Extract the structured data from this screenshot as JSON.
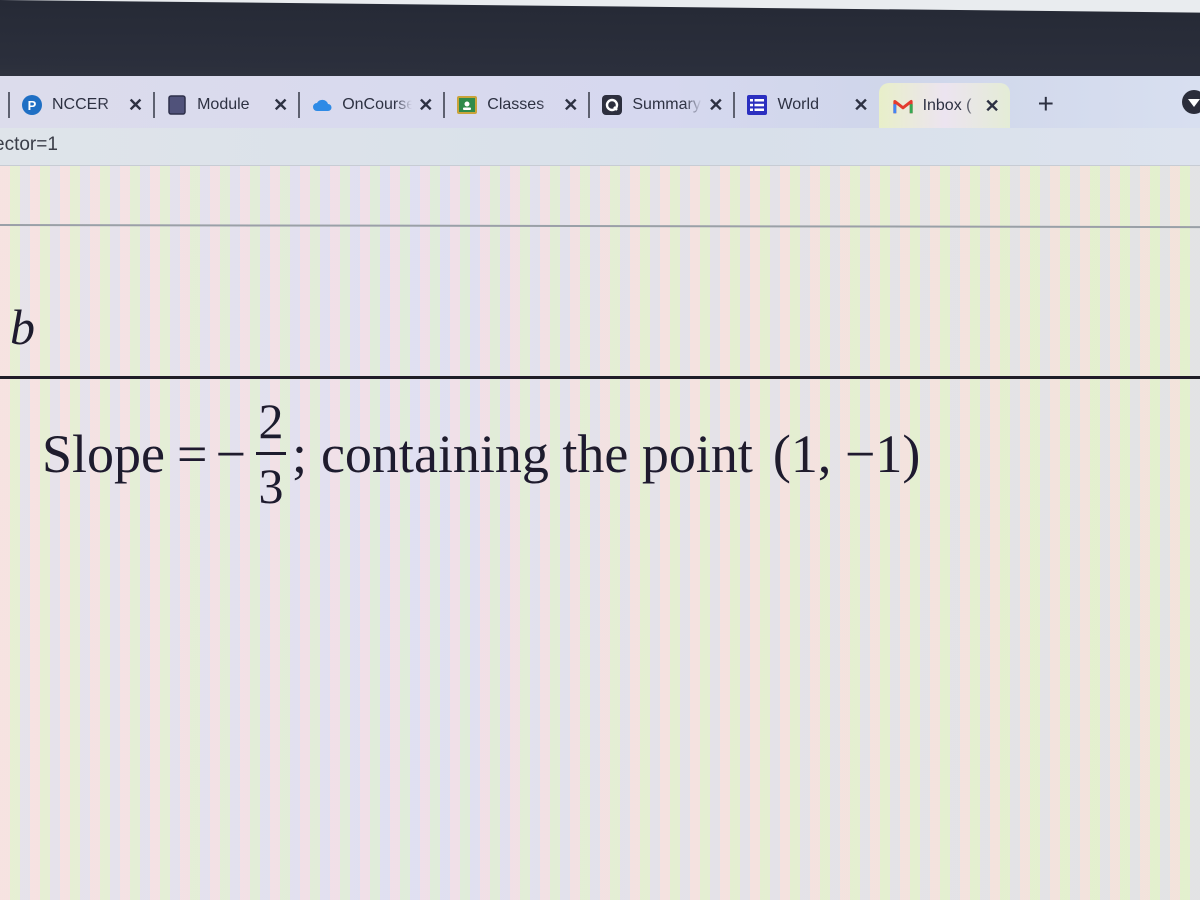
{
  "browser": {
    "tabs": [
      {
        "title": "NCCER",
        "icon": "pearson-icon",
        "active": false
      },
      {
        "title": "Module",
        "icon": "book-icon",
        "active": false
      },
      {
        "title": "OnCourse",
        "icon": "cloud-icon",
        "active": false
      },
      {
        "title": "Classes",
        "icon": "google-classroom-icon",
        "active": false
      },
      {
        "title": "Summary",
        "icon": "quizizz-icon",
        "active": false
      },
      {
        "title": "World",
        "icon": "list-form-icon",
        "active": false
      },
      {
        "title": "Inbox (",
        "icon": "gmail-icon",
        "active": true
      }
    ],
    "close_glyph": "✕",
    "new_tab_glyph": "+",
    "url_fragment": "ector=1"
  },
  "content": {
    "part_label": "b",
    "equation": {
      "lhs": "Slope",
      "equals": "=",
      "sign": "−",
      "numerator": "2",
      "denominator": "3",
      "separator": ";",
      "text": "containing the point",
      "point": "(1, −1)"
    }
  }
}
